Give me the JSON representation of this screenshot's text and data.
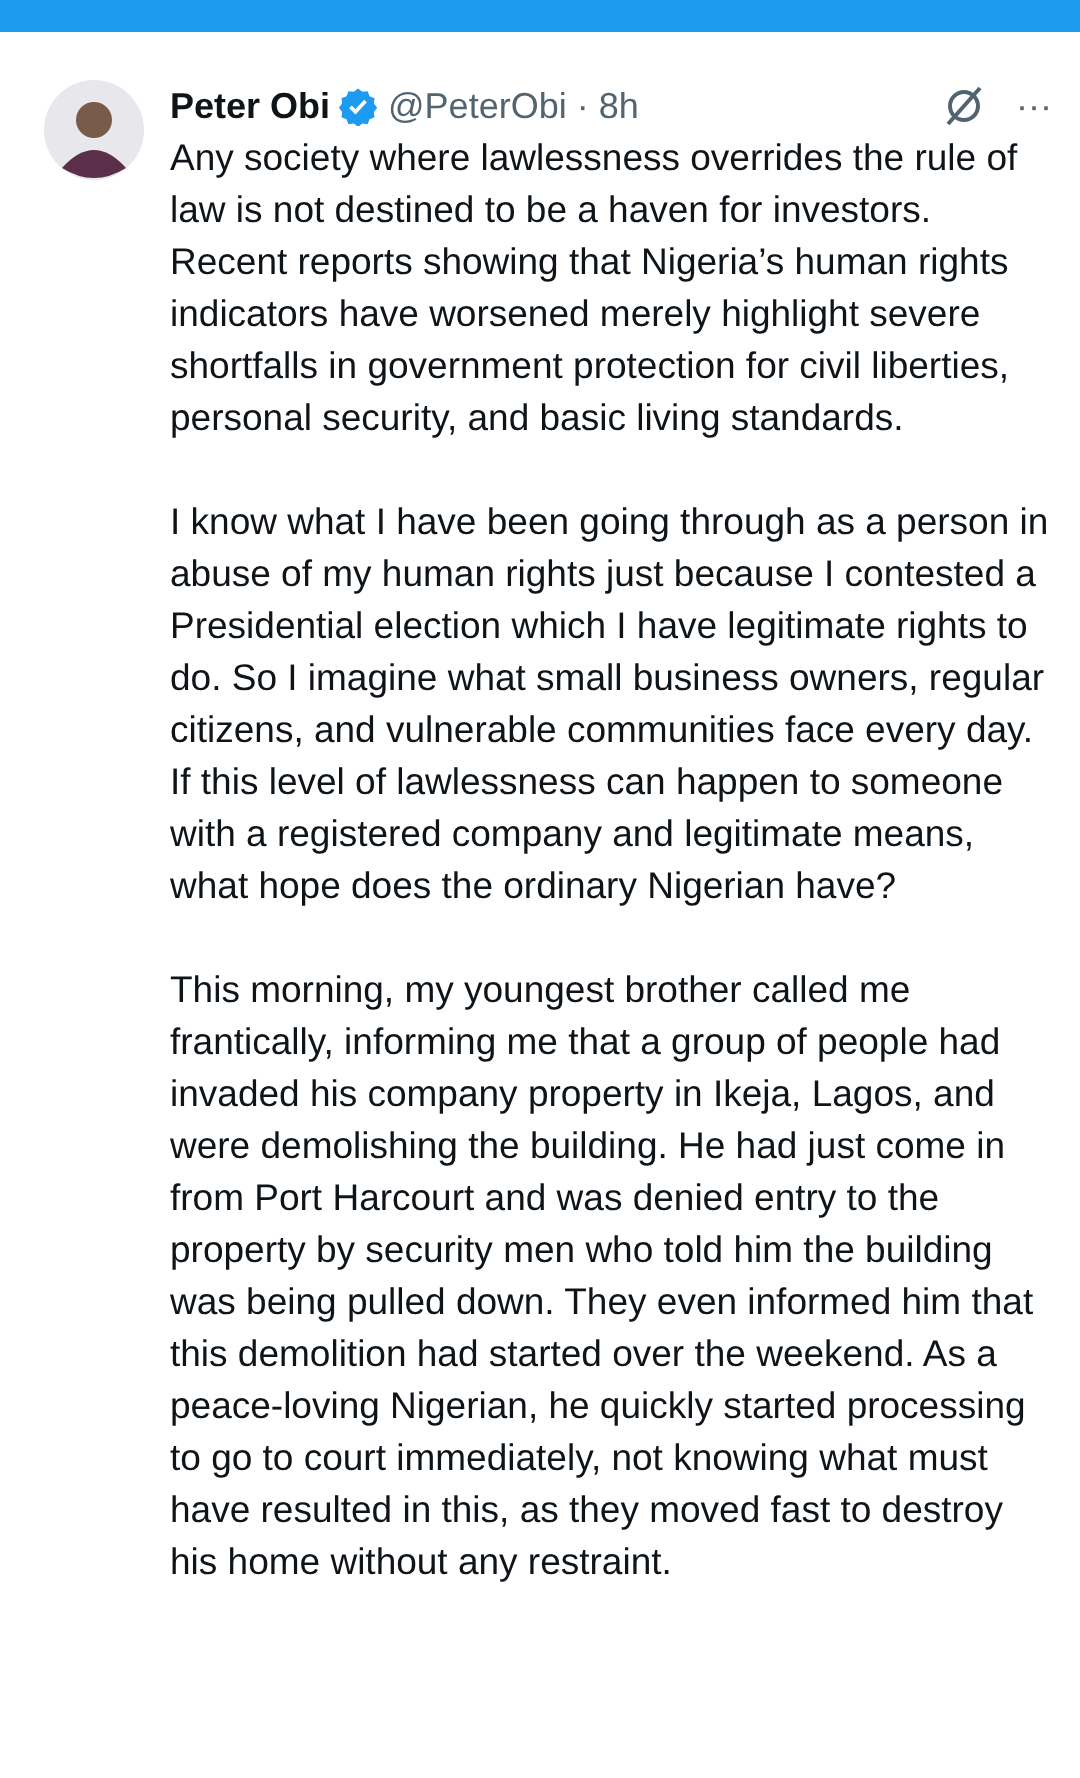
{
  "tweet": {
    "name": "Peter Obi",
    "verified": true,
    "handle": "@PeterObi",
    "separator": "·",
    "time": "8h",
    "more": "···",
    "paragraphs": [
      "Any society where lawlessness overrides the rule of law is not destined to be a haven for investors. Recent reports showing that Nigeria’s human rights indicators have worsened merely highlight severe shortfalls in government protection for civil liberties, personal security, and basic living standards.",
      "I know what I have been going through as a person in abuse of my human rights just because I contested a Presidential election which I have legitimate rights to do. So I imagine what small business owners, regular citizens, and vulnerable communities face every day. If this level of lawlessness can happen to someone with a registered company and legitimate means, what hope does the ordinary Nigerian have?",
      "This morning, my youngest brother called me frantically, informing me that a group of people had invaded his company property in Ikeja, Lagos, and were demolishing the building. He had just come in from Port Harcourt and was denied entry to the property by security men who told him the building was being pulled down. They even informed him that this demolition had started over the weekend. As a peace-loving Nigerian, he quickly started processing to go to court immediately, not knowing what must have resulted in this, as they moved fast to destroy his home without any restraint."
    ]
  }
}
